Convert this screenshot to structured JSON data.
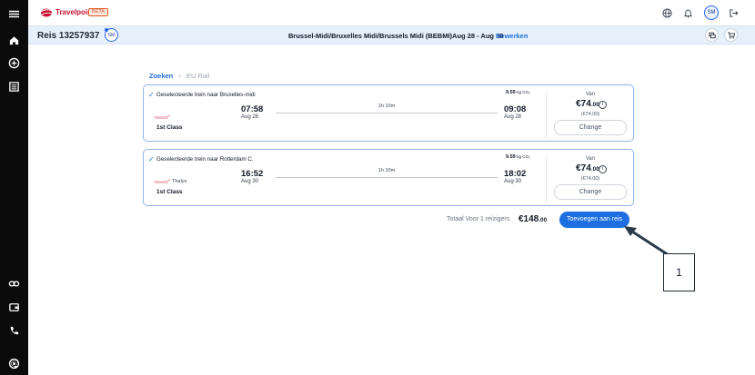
{
  "app": {
    "logo_text": "Travelpoint",
    "beta_label": "BETA",
    "user_initials": "SM"
  },
  "colors": {
    "accent": "#1d6fe0",
    "sidebar": "#0b0b0b",
    "tripbar": "#e6f0fb",
    "card_border": "#8fb4ea"
  },
  "sidebar": {
    "items": [
      {
        "icon": "menu-icon"
      },
      {
        "icon": "home-icon"
      },
      {
        "icon": "plus-circle-icon"
      },
      {
        "icon": "list-icon"
      },
      {
        "icon": "link-icon"
      },
      {
        "icon": "wallet-icon"
      },
      {
        "icon": "phone-icon"
      },
      {
        "icon": "at-icon"
      }
    ]
  },
  "trip": {
    "title": "Reis 13257937",
    "avatar": "SM",
    "route": "Brussel-Midi/Bruxelles Midi/Brussels Midi (BEBMI)Aug 28 - Aug 30",
    "edit_label": "Bewerken"
  },
  "breadcrumb": {
    "link": "Zoeken",
    "separator": "›",
    "current": "EU Rail"
  },
  "journeys": [
    {
      "header": "Geselecteerde trein naar Bruxelles-midi",
      "emissions_value": "9.59",
      "emissions_unit": "kg CO₂",
      "operator": "",
      "class_label": "1st Class",
      "departure_time": "07:58",
      "departure_date": "Aug 28",
      "duration": "1h 10m",
      "arrival_time": "09:08",
      "arrival_date": "Aug 28",
      "from_label": "Van",
      "price": "€74",
      "price_cents": ".00",
      "price_sub": "(€74.00)",
      "change_label": "Change"
    },
    {
      "header": "Geselecteerde trein naar Rotterdam C.",
      "emissions_value": "9.59",
      "emissions_unit": "kg CO₂",
      "operator": "Thalys",
      "class_label": "1st Class",
      "departure_time": "16:52",
      "departure_date": "Aug 30",
      "duration": "1h 10m",
      "arrival_time": "18:02",
      "arrival_date": "Aug 30",
      "from_label": "Van",
      "price": "€74",
      "price_cents": ".00",
      "price_sub": "(€74.00)",
      "change_label": "Change"
    }
  ],
  "summary": {
    "total_label": "Totaal Voor 1 reizigers",
    "total_amount": "€148",
    "total_cents": ".00",
    "add_button": "Toevoegen aan reis"
  },
  "annotation": {
    "label": "1"
  }
}
